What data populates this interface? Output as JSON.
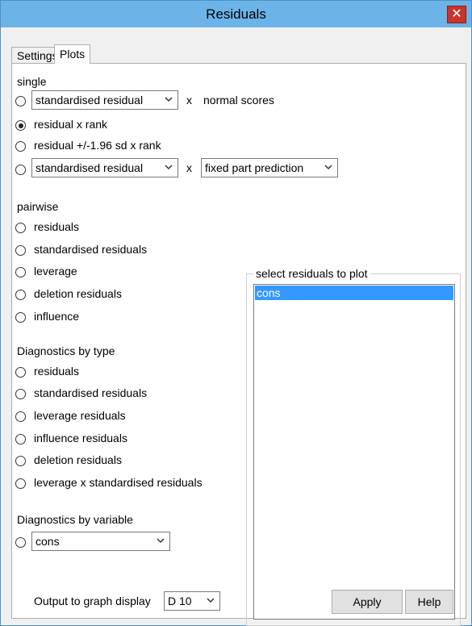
{
  "window": {
    "title": "Residuals",
    "close_symbol": "✕"
  },
  "tabs": [
    {
      "label": "Settings",
      "active": false
    },
    {
      "label": "Plots",
      "active": true
    }
  ],
  "single": {
    "heading": "single",
    "row1": {
      "combo": "standardised residual",
      "x": "x",
      "suffix": "normal scores"
    },
    "row2": {
      "label": "residual x rank"
    },
    "row3": {
      "label": "residual +/-1.96 sd x  rank"
    },
    "row4": {
      "combo1": "standardised residual",
      "x": "x",
      "combo2": "fixed part prediction"
    },
    "selected": "row2"
  },
  "pairwise": {
    "heading": "pairwise",
    "options": [
      "residuals",
      "standardised residuals",
      "leverage",
      "deletion residuals",
      "influence"
    ]
  },
  "diagnostics_by_type": {
    "heading": "Diagnostics by type",
    "options": [
      "residuals",
      "standardised residuals",
      "leverage residuals",
      "influence residuals",
      "deletion residuals",
      "leverage x standardised residuals"
    ]
  },
  "diagnostics_by_variable": {
    "heading": "Diagnostics by variable",
    "combo": "cons"
  },
  "select_residuals": {
    "label": "select residuals to plot",
    "items": [
      "cons"
    ]
  },
  "output": {
    "label": "Output to graph display",
    "combo": "D 10"
  },
  "buttons": {
    "apply": "Apply",
    "help": "Help"
  }
}
